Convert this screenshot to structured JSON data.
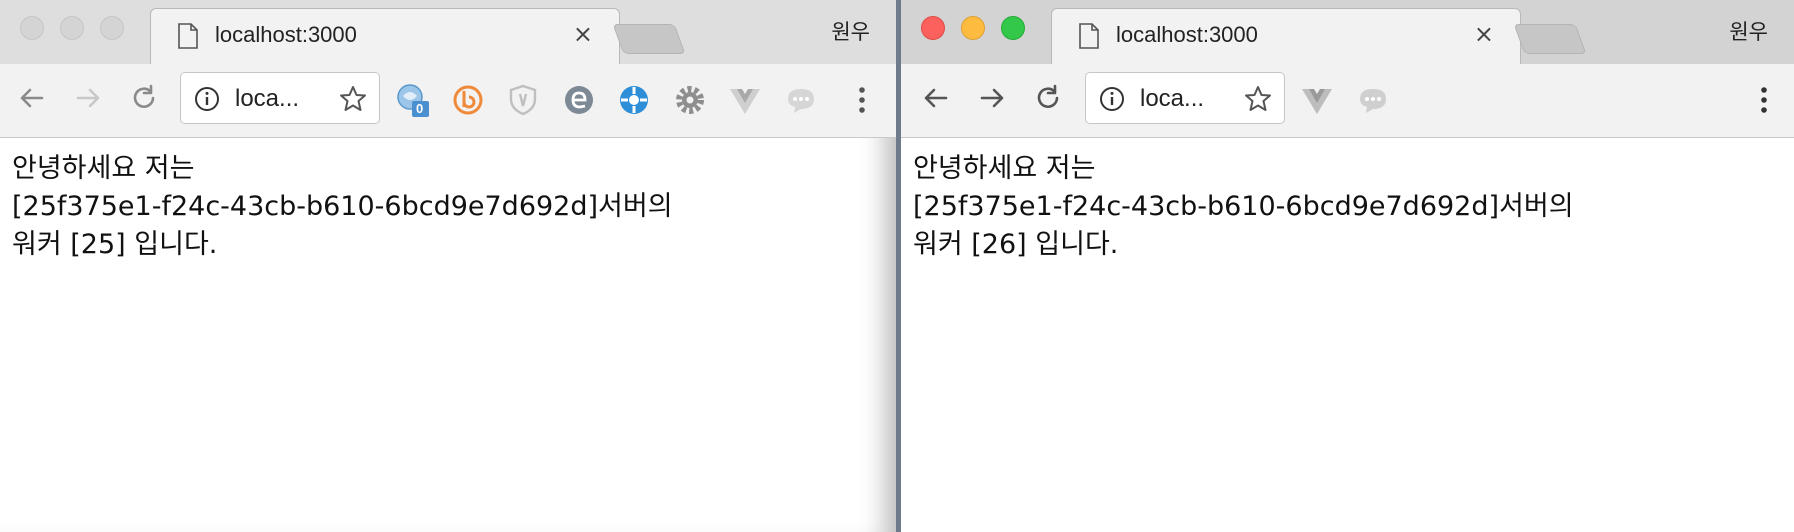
{
  "windows": {
    "left": {
      "profile_name": "원우",
      "tab": {
        "title": "localhost:3000",
        "close_label": "×"
      },
      "omnibox": {
        "text": "loca..."
      },
      "content": {
        "line1": "안녕하세요 저는",
        "line2": "[25f375e1-f24c-43cb-b610-6bcd9e7d692d]서버의",
        "line3": "워커 [25] 입니다."
      },
      "extensions": [
        {
          "icon": "globe-badge-icon",
          "badge": "0"
        },
        {
          "icon": "bitly-icon"
        },
        {
          "icon": "shield-icon"
        },
        {
          "icon": "e-icon"
        },
        {
          "icon": "crosshair-icon"
        },
        {
          "icon": "gear-icon"
        },
        {
          "icon": "vue-icon"
        },
        {
          "icon": "chat-bubble-icon"
        }
      ]
    },
    "right": {
      "profile_name": "원우",
      "tab": {
        "title": "localhost:3000",
        "close_label": "×"
      },
      "omnibox": {
        "text": "loca..."
      },
      "content": {
        "line1": "안녕하세요 저는",
        "line2": "[25f375e1-f24c-43cb-b610-6bcd9e7d692d]서버의",
        "line3": "워커 [26] 입니다."
      },
      "extensions": [
        {
          "icon": "vue-icon"
        },
        {
          "icon": "chat-bubble-icon"
        }
      ]
    }
  },
  "colors": {
    "traffic_close": "#fc615d",
    "traffic_minimize": "#fdbc40",
    "traffic_maximize": "#34c84a",
    "ext_blue": "#2e8fd8",
    "ext_orange": "#ef8a3b"
  }
}
